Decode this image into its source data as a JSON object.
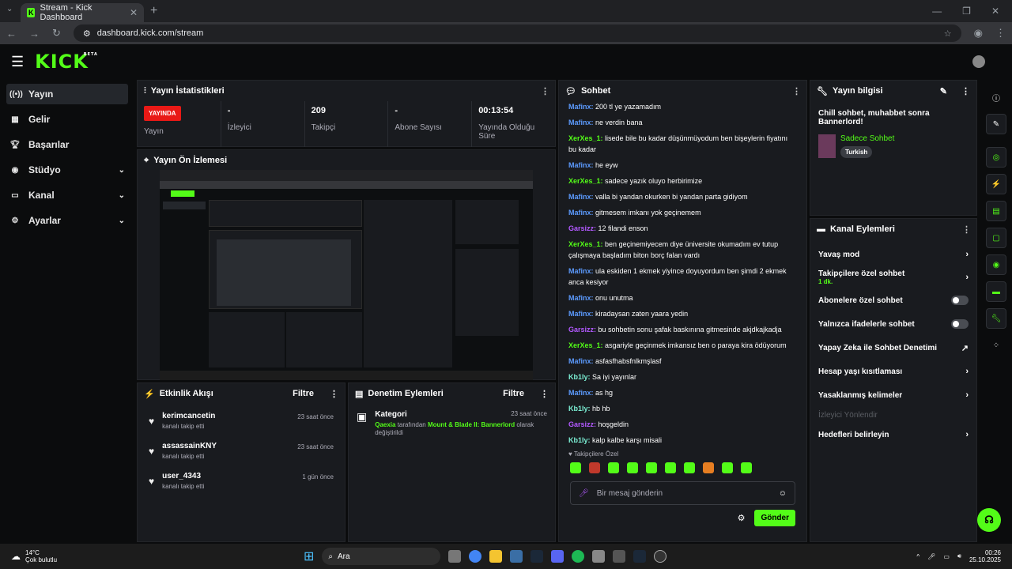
{
  "browser": {
    "tab_title": "Stream - Kick Dashboard",
    "url": "dashboard.kick.com/stream"
  },
  "brand": {
    "logo": "KICK",
    "beta": "BETA"
  },
  "sidebar": {
    "items": [
      {
        "label": "Yayın",
        "icon": "broadcast-icon"
      },
      {
        "label": "Gelir",
        "icon": "chart-icon"
      },
      {
        "label": "Başarılar",
        "icon": "trophy-icon"
      },
      {
        "label": "Stüdyo",
        "icon": "studio-icon"
      },
      {
        "label": "Kanal",
        "icon": "channel-icon"
      },
      {
        "label": "Ayarlar",
        "icon": "gear-icon"
      }
    ]
  },
  "stats": {
    "title": "Yayın İstatistikleri",
    "live_badge": "YAYINDA",
    "status_label": "Yayın",
    "viewers_value": "-",
    "viewers_label": "İzleyici",
    "followers_value": "209",
    "followers_label": "Takipçi",
    "subs_value": "-",
    "subs_label": "Abone Sayısı",
    "duration_value": "00:13:54",
    "duration_label": "Yayında Olduğu Süre"
  },
  "preview": {
    "title": "Yayın Ön İzlemesi"
  },
  "activity": {
    "title": "Etkinlik Akışı",
    "filter": "Filtre",
    "items": [
      {
        "name": "kerimcancetin",
        "sub": "kanalı takip etti",
        "time": "23 saat önce"
      },
      {
        "name": "assassainKNY",
        "sub": "kanalı takip etti",
        "time": "23 saat önce"
      },
      {
        "name": "user_4343",
        "sub": "kanalı takip etti",
        "time": "1 gün önce"
      }
    ]
  },
  "moderation": {
    "title": "Denetim Eylemleri",
    "filter": "Filtre",
    "item_title": "Kategori",
    "item_time": "23 saat önce",
    "item_user": "Qaexia",
    "item_mid": " tarafından ",
    "item_game": "Mount & Blade II: Bannerlord",
    "item_end": " olarak değiştirildi"
  },
  "chat": {
    "title": "Sohbet",
    "messages": [
      {
        "user": "Mafinx",
        "cls": "b",
        "text": "200 tl ye yazamadım"
      },
      {
        "user": "Mafinx",
        "cls": "b",
        "text": "ne verdin bana"
      },
      {
        "user": "XerXes_1",
        "cls": "g",
        "text": "lisede bile bu kadar düşünmüyodum ben bişeylerin fiyatını bu kadar"
      },
      {
        "user": "Mafinx",
        "cls": "b",
        "text": "he eyw"
      },
      {
        "user": "XerXes_1",
        "cls": "g",
        "text": "sadece yazık oluyo herbirimize"
      },
      {
        "user": "Mafinx",
        "cls": "b",
        "text": "valla bi yandan okurken bi yandan parta gidiyom"
      },
      {
        "user": "Mafinx",
        "cls": "b",
        "text": "gitmesem imkanı yok geçinemem"
      },
      {
        "user": "Garsizz",
        "cls": "p",
        "text": "12 filandi enson"
      },
      {
        "user": "XerXes_1",
        "cls": "g",
        "text": "ben geçinemiyecem diye üniversite okumadım ev tutup çalışmaya başladım biton borç falan vardı"
      },
      {
        "user": "Mafinx",
        "cls": "b",
        "text": "ula eskiden 1 ekmek yiyince doyuyordum ben şimdi 2 ekmek anca kesiyor"
      },
      {
        "user": "Mafinx",
        "cls": "b",
        "text": "onu unutma"
      },
      {
        "user": "Mafinx",
        "cls": "b",
        "text": "kiradaysan zaten yaara yedin"
      },
      {
        "user": "Garsizz",
        "cls": "p",
        "text": "bu sohbetin sonu şafak baskınına gitmesinde akjdkajkadja"
      },
      {
        "user": "XerXes_1",
        "cls": "g",
        "text": "asgariyle geçinmek imkansız ben o paraya kira ödüyorum"
      },
      {
        "user": "Mafinx",
        "cls": "b",
        "text": "asfasfhabsfnlkmşlasf"
      },
      {
        "user": "Kb1ly",
        "cls": "c",
        "text": "Sa iyi yayınlar"
      },
      {
        "user": "Mafinx",
        "cls": "b",
        "text": "as hg"
      },
      {
        "user": "Kb1ly",
        "cls": "c",
        "text": "hb hb"
      },
      {
        "user": "Garsizz",
        "cls": "p",
        "text": "hoşgeldin"
      },
      {
        "user": "Kb1ly",
        "cls": "c",
        "text": "kalp kalbe karşı misali"
      }
    ],
    "emote_label": "Takipçilere Özel",
    "input_placeholder": "Bir mesaj gönderin",
    "send": "Gönder"
  },
  "streaminfo": {
    "title": "Yayın bilgisi",
    "stream_title": "Chill sohbet, muhabbet sonra Bannerlord!",
    "mode": "Sadece Sohbet",
    "tag": "Turkish"
  },
  "channel_actions": {
    "title": "Kanal Eylemleri",
    "items": [
      {
        "label": "Yavaş mod",
        "type": "arrow"
      },
      {
        "label": "Takipçilere özel sohbet",
        "sub": "1 dk.",
        "type": "arrow"
      },
      {
        "label": "Abonelere özel sohbet",
        "type": "toggle"
      },
      {
        "label": "Yalnızca ifadelerle sohbet",
        "type": "toggle"
      },
      {
        "label": "Yapay Zeka ile Sohbet Denetimi",
        "type": "ext"
      },
      {
        "label": "Hesap yaşı kısıtlaması",
        "type": "arrow"
      },
      {
        "label": "Yasaklanmış kelimeler",
        "type": "arrow"
      },
      {
        "label": "İzleyici Yönlendir",
        "type": "disabled"
      },
      {
        "label": "Hedefleri belirleyin",
        "type": "arrow"
      }
    ]
  },
  "taskbar": {
    "temp": "14°C",
    "weather": "Çok bulutlu",
    "search": "Ara",
    "time": "00:26",
    "date": "25.10.2025"
  },
  "colors": {
    "accent": "#53fc18",
    "live": "#e91916",
    "panel": "#191b1f"
  }
}
